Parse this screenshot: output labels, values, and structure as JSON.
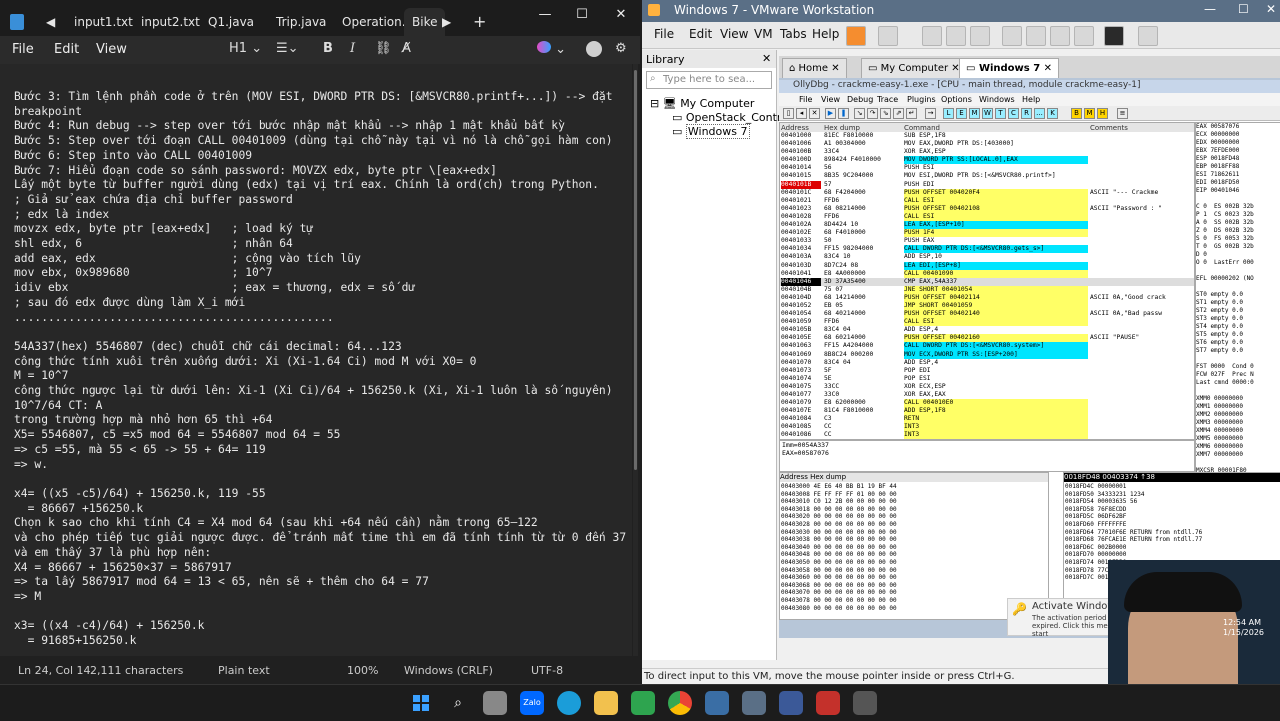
{
  "notepad": {
    "tabs": [
      "input1.txt",
      "input2.txt",
      "Q1.java",
      "Trip.java",
      "Operation.ja",
      "Bike"
    ],
    "new_tab": "+",
    "menu": [
      "File",
      "Edit",
      "View"
    ],
    "toolbar": {
      "heading": "H1",
      "bold": "B",
      "italic": "I"
    },
    "lines": [
      "Bước 3: Tìm lệnh phần code ở trên (MOV ESI, DWORD PTR DS: [&MSVCR80.printf+...]) --> đặt",
      "breakpoint",
      "Bước 4: Run debug --> step over tới bước nhập mật khẩu --> nhập 1 mật khẩu bất kỳ",
      "Bước 5: Step over tới đoạn CALL 00401009 (dùng tại chỗ này tại vì nó là chỗ gọi hàm con)",
      "Bước 6: Step into vào CALL 00401009",
      "Bước 7: Hiểu đoạn code so sánh password: MOVZX edx, byte ptr \\[eax+edx]",
      "Lấy một byte từ buffer người dùng (edx) tại vị trí eax. Chính là ord(ch) trong Python.",
      "; Giả sử eax chứa địa chỉ buffer password",
      "; edx là index",
      "movzx edx, byte ptr [eax+edx]   ; load ký tự",
      "shl edx, 6                      ; nhân 64",
      "add eax, edx                    ; cộng vào tích lũy",
      "mov ebx, 0x989680               ; 10^7",
      "idiv ebx                        ; eax = thương, edx = số dư",
      "; sau đó edx được dùng làm X_i mới",
      "...............................................",
      "",
      "54A337(hex) 5546807 (dec) chuỗi chữ cái decimal: 64...123",
      "công thức tính xuôi trên xuống dưới: Xi (Xi-1.64 Ci) mod M với X0= 0",
      "M = 10^7",
      "công thức ngược lại từ dưới lên: Xi-1 (Xi Ci)/64 + 156250.k (Xi, Xi-1 luôn là số nguyên)",
      "10^7/64 CT: A",
      "trong trường hợp mà nhỏ hơn 65 thì +64",
      "X5= 5546807, c5 =x5 mod 64 = 5546807 mod 64 = 55",
      "=> c5 =55, mà 55 < 65 -> 55 + 64= 119",
      "=> w.",
      "",
      "x4= ((x5 -c5)/64) + 156250.k, 119 -55",
      "  = 86667 +156250.k",
      "Chọn k sao cho khi tính C4 = X4 mod 64 (sau khi +64 nếu cần) nằm trong 65–122",
      "và cho phép tiếp tục giải ngược được. để tránh mất time thì em đã tính tính từ từ 0 đến 37",
      "và em thấy 37 là phù hợp nên:",
      "X4 = 86667 + 156250×37 = 5867917",
      "=> ta lấy 5867917 mod 64 = 13 < 65, nên sẽ + thêm cho 64 = 77",
      "=> M",
      "",
      "x3= ((x4 -c4)/64) + 156250.k",
      "  = 91685+156250.k"
    ],
    "status": {
      "position": "Ln 24, Col 14",
      "chars": "2,111 characters",
      "format": "Plain text",
      "zoom": "100%",
      "eol": "Windows (CRLF)",
      "encoding": "UTF-8"
    }
  },
  "vmware": {
    "title": "Windows 7 - VMware Workstation",
    "menu": [
      "File",
      "Edit",
      "View",
      "VM",
      "Tabs",
      "Help"
    ],
    "library": {
      "title": "Library",
      "search_placeholder": "Type here to sea...",
      "root": "My Computer",
      "items": [
        "OpenStack_Contr",
        "Windows 7"
      ]
    },
    "tabs": [
      "Home",
      "My Computer",
      "Windows 7"
    ],
    "status_text": "To direct input to this VM, move the mouse pointer inside or press Ctrl+G."
  },
  "olly": {
    "title": "OllyDbg - crackme-easy-1.exe - [CPU - main thread, module crackme-easy-1]",
    "menu": [
      "File",
      "View",
      "Debug",
      "Trace",
      "Plugins",
      "Options",
      "Windows",
      "Help"
    ],
    "toolbar_letters": [
      "L",
      "E",
      "M",
      "W",
      "T",
      "C",
      "R",
      "...",
      "K",
      "B",
      "M",
      "H"
    ],
    "columns": [
      "Address",
      "Hex dump",
      "Command",
      "Comments"
    ],
    "rows": [
      {
        "a": "00401000",
        "h": "81EC F8010000",
        "c": "SUB ESP,1F8",
        "m": ""
      },
      {
        "a": "00401006",
        "h": "A1 00304000",
        "c": "MOV EAX,DWORD PTR DS:[403000]",
        "m": ""
      },
      {
        "a": "0040100B",
        "h": "33C4",
        "c": "XOR EAX,ESP",
        "m": ""
      },
      {
        "a": "0040100D",
        "h": "898424 F4010000",
        "c": "MOV DWORD PTR SS:[LOCAL.0],EAX",
        "m": ""
      },
      {
        "a": "00401014",
        "h": "56",
        "c": "PUSH ESI",
        "m": ""
      },
      {
        "a": "00401015",
        "h": "8B35 9C204000",
        "c": "MOV ESI,DWORD PTR DS:[<&MSVCR80.printf>]",
        "m": ""
      },
      {
        "a": "0040101B",
        "h": "57",
        "c": "PUSH EDI",
        "m": ""
      },
      {
        "a": "0040101C",
        "h": "68 F4204000",
        "c": "PUSH OFFSET 004020F4",
        "m": "ASCII \"--- Crackme"
      },
      {
        "a": "00401021",
        "h": "FFD6",
        "c": "CALL ESI",
        "m": ""
      },
      {
        "a": "00401023",
        "h": "68 08214000",
        "c": "PUSH OFFSET 00402108",
        "m": "ASCII \"Password : \""
      },
      {
        "a": "00401028",
        "h": "FFD6",
        "c": "CALL ESI",
        "m": ""
      },
      {
        "a": "0040102A",
        "h": "8D4424 10",
        "c": "LEA EAX,[ESP+10]",
        "m": ""
      },
      {
        "a": "0040102E",
        "h": "68 F4010000",
        "c": "PUSH 1F4",
        "m": ""
      },
      {
        "a": "00401033",
        "h": "50",
        "c": "PUSH EAX",
        "m": ""
      },
      {
        "a": "00401034",
        "h": "FF15 98204000",
        "c": "CALL DWORD PTR DS:[<&MSVCR80.gets_s>]",
        "m": ""
      },
      {
        "a": "0040103A",
        "h": "83C4 10",
        "c": "ADD ESP,10",
        "m": ""
      },
      {
        "a": "0040103D",
        "h": "8D7C24 08",
        "c": "LEA EDI,[ESP+8]",
        "m": ""
      },
      {
        "a": "00401041",
        "h": "E8 4A000000",
        "c": "CALL 00401090",
        "m": ""
      },
      {
        "a": "00401046",
        "h": "3D 37A35400",
        "c": "CMP EAX,54A337",
        "m": ""
      },
      {
        "a": "0040104B",
        "h": "75 07",
        "c": "JNE SHORT 00401054",
        "m": ""
      },
      {
        "a": "0040104D",
        "h": "68 14214000",
        "c": "PUSH OFFSET 00402114",
        "m": "ASCII 0A,\"Good crack"
      },
      {
        "a": "00401052",
        "h": "EB 05",
        "c": "JMP SHORT 00401059",
        "m": ""
      },
      {
        "a": "00401054",
        "h": "68 40214000",
        "c": "PUSH OFFSET 00402140",
        "m": "ASCII 0A,\"Bad passw"
      },
      {
        "a": "00401059",
        "h": "FFD6",
        "c": "CALL ESI",
        "m": ""
      },
      {
        "a": "0040105B",
        "h": "83C4 04",
        "c": "ADD ESP,4",
        "m": ""
      },
      {
        "a": "0040105E",
        "h": "68 60214000",
        "c": "PUSH OFFSET 00402160",
        "m": "ASCII \"PAUSE\""
      },
      {
        "a": "00401063",
        "h": "FF15 A4204000",
        "c": "CALL DWORD PTR DS:[<&MSVCR80.system>]",
        "m": ""
      },
      {
        "a": "00401069",
        "h": "8B8C24 000200",
        "c": "MOV ECX,DWORD PTR SS:[ESP+200]",
        "m": ""
      },
      {
        "a": "00401070",
        "h": "83C4 04",
        "c": "ADD ESP,4",
        "m": ""
      },
      {
        "a": "00401073",
        "h": "5F",
        "c": "POP EDI",
        "m": ""
      },
      {
        "a": "00401074",
        "h": "5E",
        "c": "POP ESI",
        "m": ""
      },
      {
        "a": "00401075",
        "h": "33CC",
        "c": "XOR ECX,ESP",
        "m": ""
      },
      {
        "a": "00401077",
        "h": "33C0",
        "c": "XOR EAX,EAX",
        "m": ""
      },
      {
        "a": "00401079",
        "h": "E8 62000000",
        "c": "CALL 004010E0",
        "m": ""
      },
      {
        "a": "0040107E",
        "h": "81C4 F8010000",
        "c": "ADD ESP,1F8",
        "m": ""
      },
      {
        "a": "00401084",
        "h": "C3",
        "c": "RETN",
        "m": ""
      },
      {
        "a": "00401085",
        "h": "CC",
        "c": "INT3",
        "m": ""
      },
      {
        "a": "00401086",
        "h": "CC",
        "c": "INT3",
        "m": ""
      }
    ],
    "info_lines": [
      "Imm=0054A337",
      "EAX=00587076"
    ],
    "registers": "EAX 00587076\nECX 00000000\nEDX 00000000\nEBX 7EFDE000\nESP 0018FD48\nEBP 0018FF88\nESI 71862611\nEDI 0018FD50\nEIP 00401046\n\nC 0  ES 002B 32b\nP 1  CS 0023 32b\nA 0  SS 002B 32b\nZ 0  DS 002B 32b\nS 0  FS 0053 32b\nT 0  GS 002B 32b\nD 0\nO 0  LastErr 000\n\nEFL 00000202 (NO\n\nST0 empty 0.0\nST1 empty 0.0\nST2 empty 0.0\nST3 empty 0.0\nST4 empty 0.0\nST5 empty 0.0\nST6 empty 0.0\nST7 empty 0.0\n\nFST 0000  Cond 0\nFCW 027F  Prec N\nLast cmnd 0000:0\n\nXMM0 00000000\nXMM1 00000000\nXMM2 00000000\nXMM3 00000000\nXMM4 00000000\nXMM5 00000000\nXMM6 00000000\nXMM7 00000000\n\nMXCSR 00001F80",
    "dump_head": "Address  Hex dump",
    "dump_rows": [
      "00403000  4E E6 40 BB B1 19 BF 44",
      "00403008  FE FF FF FF 01 00 00 00",
      "00403010  C0 12 2B 00 00 00 00 00",
      "00403018  00 00 00 00 00 00 00 00",
      "00403020  00 00 00 00 00 00 00 00",
      "00403028  00 00 00 00 00 00 00 00",
      "00403030  00 00 00 00 00 00 00 00",
      "00403038  00 00 00 00 00 00 00 00",
      "00403040  00 00 00 00 00 00 00 00",
      "00403048  00 00 00 00 00 00 00 00",
      "00403050  00 00 00 00 00 00 00 00",
      "00403058  00 00 00 00 00 00 00 00",
      "00403060  00 00 00 00 00 00 00 00",
      "00403068  00 00 00 00 00 00 00 00",
      "00403070  00 00 00 00 00 00 00 00",
      "00403078  00 00 00 00 00 00 00 00",
      "00403080  00 00 00 00 00 00 00 00"
    ],
    "stack_head": "0018FD48  00403374  ↑38",
    "stack_rows": [
      "0018FD4C  00000001",
      "0018FD50  34333231  1234",
      "0018FD54  00003635  56",
      "0018FD58  76F8ECDD",
      "0018FD5C  06DF62BF",
      "0018FD60  FFFFFFFE",
      "0018FD64  77010F6E  RETURN from ntdll.76",
      "0018FD68  76FCAE1E  RETURN from ntdll.77",
      "0018FD6C  002B0000",
      "0018FD70  00000000",
      "0018FD74  0018FDB0",
      "0018FD78  77C7C5A3",
      "0018FD7C  0018FDD8"
    ],
    "activate_title": "Activate Windows",
    "activate_text": "The activation period has expired. Click this message to start"
  },
  "windows7": {
    "time": "12:54 AM",
    "date": "1/15/2026"
  },
  "colors": {
    "notepad_bg": "#272727",
    "vmware_title": "#5a6f86",
    "breakpoint": "#dd0000",
    "highlight_yellow": "#ffff66",
    "highlight_cyan": "#00e5ff"
  }
}
